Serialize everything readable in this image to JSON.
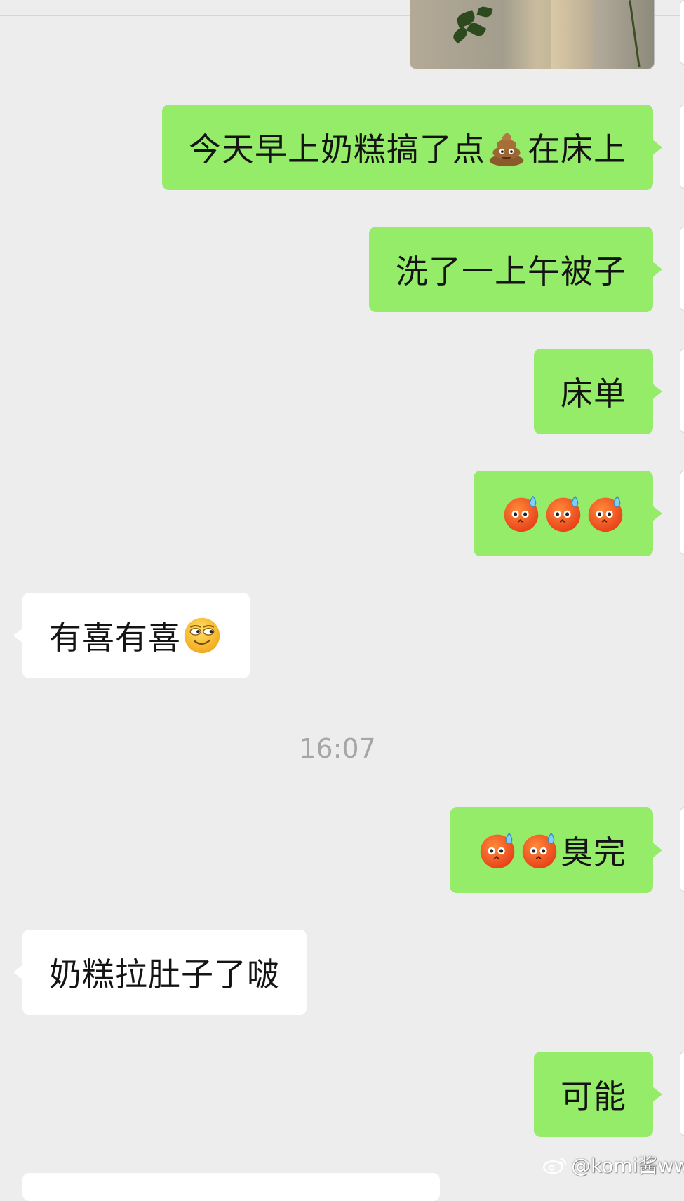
{
  "messages": [
    {
      "side": "out",
      "segments": [
        {
          "type": "text",
          "value": "今天早上奶糕搞了点"
        },
        {
          "type": "emoji",
          "name": "poop-emoji"
        },
        {
          "type": "text",
          "value": "在床上"
        }
      ]
    },
    {
      "side": "out",
      "segments": [
        {
          "type": "text",
          "value": "洗了一上午被子"
        }
      ]
    },
    {
      "side": "out",
      "segments": [
        {
          "type": "text",
          "value": "床单"
        }
      ]
    },
    {
      "side": "out",
      "segments": [
        {
          "type": "emoji",
          "name": "sweating-face-emoji"
        },
        {
          "type": "emoji",
          "name": "sweating-face-emoji"
        },
        {
          "type": "emoji",
          "name": "sweating-face-emoji"
        }
      ]
    },
    {
      "side": "in",
      "segments": [
        {
          "type": "text",
          "value": "有喜有喜"
        },
        {
          "type": "emoji",
          "name": "smug-face-emoji"
        }
      ]
    },
    {
      "side": "out",
      "segments": [
        {
          "type": "emoji",
          "name": "sweating-face-emoji"
        },
        {
          "type": "emoji",
          "name": "sweating-face-emoji"
        },
        {
          "type": "text",
          "value": "臭完"
        }
      ]
    },
    {
      "side": "in",
      "segments": [
        {
          "type": "text",
          "value": "奶糕拉肚子了啵"
        }
      ]
    },
    {
      "side": "out",
      "segments": [
        {
          "type": "text",
          "value": "可能"
        }
      ]
    }
  ],
  "timestamp": "16:07",
  "watermark": "@komi酱ww",
  "colors": {
    "background": "#ededed",
    "outgoing_bubble": "#95ec69",
    "incoming_bubble": "#ffffff",
    "timestamp_text": "#a6a6a6"
  }
}
